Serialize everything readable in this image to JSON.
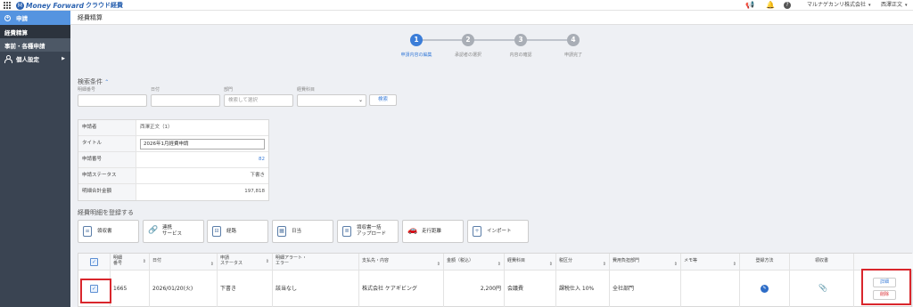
{
  "topbar": {
    "logo_mark": "M",
    "logo_text": "Money Forward",
    "logo_sub": "クラウド経費",
    "company": "マルナゲカンリ株式会社",
    "user": "西澤正文",
    "caret": "▾"
  },
  "sidebar": {
    "header": "申請",
    "items": [
      {
        "label": "経費精算"
      },
      {
        "label": "事前・各種申請"
      },
      {
        "label": "個人設定"
      }
    ]
  },
  "page": {
    "title": "経費精算"
  },
  "steps": [
    {
      "num": "1",
      "label": "申請内容の編集",
      "current": true
    },
    {
      "num": "2",
      "label": "承認者の選択",
      "current": false
    },
    {
      "num": "3",
      "label": "内容の確認",
      "current": false
    },
    {
      "num": "4",
      "label": "申請完了",
      "current": false
    }
  ],
  "search": {
    "title": "検索条件",
    "toggle": "⌃",
    "labels": [
      "明細番号",
      "日付",
      "部門",
      "経費科目"
    ],
    "dept_placeholder": "検索して選択",
    "button": "検索"
  },
  "report": {
    "rows": [
      {
        "key": "申請者",
        "value": "西澤正文（1）"
      },
      {
        "key": "タイトル",
        "value": "2026年1月経費申請"
      },
      {
        "key": "申請番号",
        "value": "82"
      },
      {
        "key": "申請ステータス",
        "value": "下書き"
      },
      {
        "key": "明細合計金額",
        "value": "197,818"
      }
    ]
  },
  "register": {
    "title": "経費明細を登録する",
    "buttons": [
      {
        "label": "領収書",
        "label2": ""
      },
      {
        "label": "連携",
        "label2": "サービス"
      },
      {
        "label": "経路",
        "label2": ""
      },
      {
        "label": "日当",
        "label2": ""
      },
      {
        "label": "領収書一括",
        "label2": "アップロード"
      },
      {
        "label": "走行距離",
        "label2": ""
      },
      {
        "label": "インポート",
        "label2": ""
      }
    ]
  },
  "table": {
    "headers": [
      "",
      "明細\n番号",
      "日付",
      "申請\nステータス",
      "明細アラート・\nエラー",
      "支払先・内容",
      "金額（税込）",
      "経費科目",
      "税区分",
      "費用負担部門",
      "メモ等",
      "登録方法",
      "領収書",
      ""
    ],
    "row": {
      "id": "1665",
      "date": "2026/01/20(火)",
      "status": "下書き",
      "alert": "該当なし",
      "payee": "株式会社 ケアギビング",
      "amount": "2,200円",
      "account": "会議費",
      "tax": "課税仕入 10%",
      "dept": "全社部門",
      "memo": ""
    },
    "actions": {
      "detail": "詳細",
      "delete": "削除"
    }
  },
  "icons": {
    "check": "✓",
    "sort": "⇕"
  },
  "colors": {
    "accent": "#3b7dd8",
    "sidebar": "#3a4452",
    "highlight": "#d9262c"
  }
}
